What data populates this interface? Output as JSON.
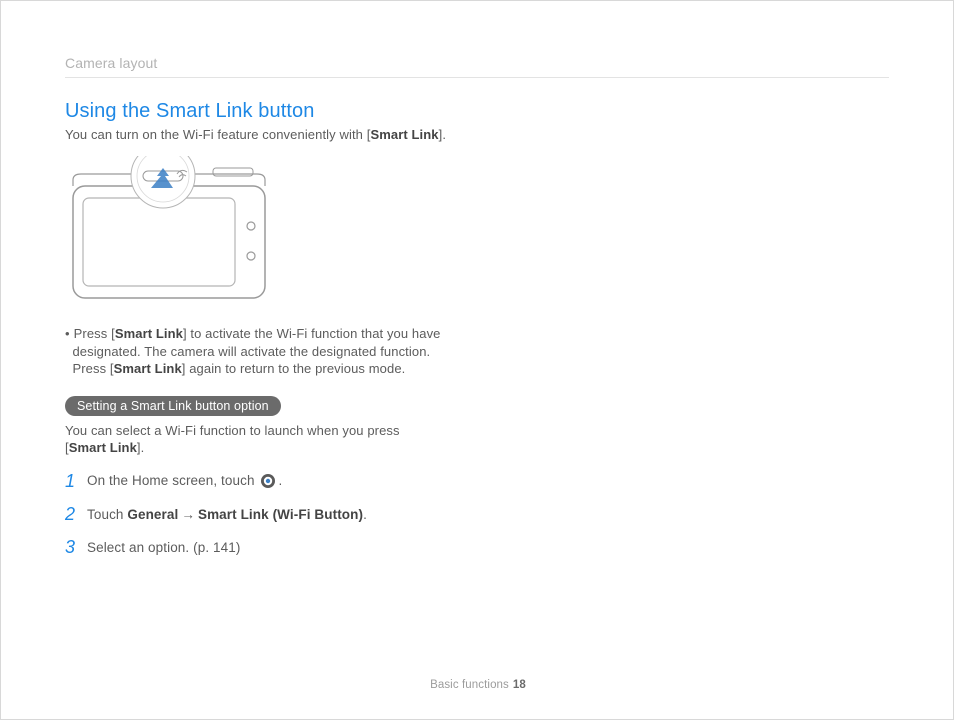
{
  "header": {
    "section": "Camera layout"
  },
  "title": "Using the Smart Link button",
  "intro": {
    "pre": "You can turn on the Wi-Fi feature conveniently with [",
    "bold": "Smart Link",
    "post": "]."
  },
  "bullet": {
    "line1_pre": "Press [",
    "line1_bold": "Smart Link",
    "line1_post": "] to activate the Wi-Fi function that you have",
    "line2": "designated. The camera will activate the designated function.",
    "line3_pre": "Press [",
    "line3_bold": "Smart Link",
    "line3_post": "] again to return to the previous mode."
  },
  "pill": "Setting a Smart Link button option",
  "sub": {
    "line1": "You can select a Wi-Fi function to launch when you press",
    "line2_pre": "[",
    "line2_bold": "Smart Link",
    "line2_post": "]."
  },
  "steps": [
    {
      "num": "1",
      "pre": "On the Home screen, touch ",
      "post": "."
    },
    {
      "num": "2",
      "pre": "Touch ",
      "b1": "General",
      "arrow": "→",
      "b2": "Smart Link (Wi-Fi Button)",
      "post": "."
    },
    {
      "num": "3",
      "pre": "Select an option. (p. 141)"
    }
  ],
  "footer": {
    "label": "Basic functions",
    "page": "18"
  }
}
